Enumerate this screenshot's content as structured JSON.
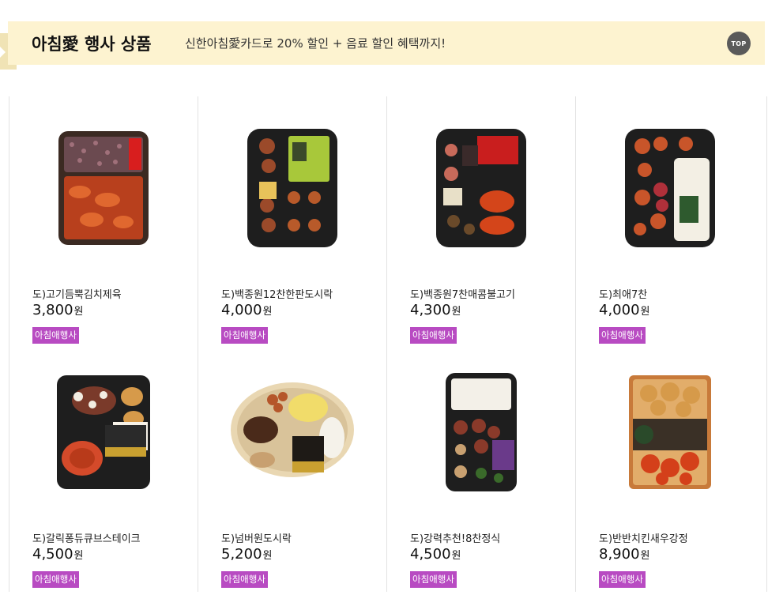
{
  "banner": {
    "title": "아침愛 행사 상품",
    "subtitle": "신한아침愛카드로 20% 할인 + 음료 할인 혜택까지!",
    "top_label": "TOP"
  },
  "currency": "원",
  "products": [
    {
      "name": "도)고기듬뿍김치제육",
      "price": "3,800",
      "badge": "아침애행사",
      "image": "kimchi-pork-lunchbox"
    },
    {
      "name": "도)백종원12찬한판도시락",
      "price": "4,000",
      "badge": "아침애행사",
      "image": "12-side-lunchbox"
    },
    {
      "name": "도)백종원7찬매콤불고기",
      "price": "4,300",
      "badge": "아침애행사",
      "image": "spicy-bulgogi-lunchbox"
    },
    {
      "name": "도)최애7찬",
      "price": "4,000",
      "badge": "아침애행사",
      "image": "favorite-7-side-lunchbox"
    },
    {
      "name": "도)갈릭퐁듀큐브스테이크",
      "price": "4,500",
      "badge": "아침애행사",
      "image": "garlic-cube-steak-lunchbox"
    },
    {
      "name": "도)넘버원도시락",
      "price": "5,200",
      "badge": "아침애행사",
      "image": "number-one-lunchbox"
    },
    {
      "name": "도)강력추천!8찬정식",
      "price": "4,500",
      "badge": "아침애행사",
      "image": "8-side-set-lunchbox"
    },
    {
      "name": "도)반반치킨새우강정",
      "price": "8,900",
      "badge": "아침애행사",
      "image": "chicken-shrimp-gangjeong"
    }
  ]
}
